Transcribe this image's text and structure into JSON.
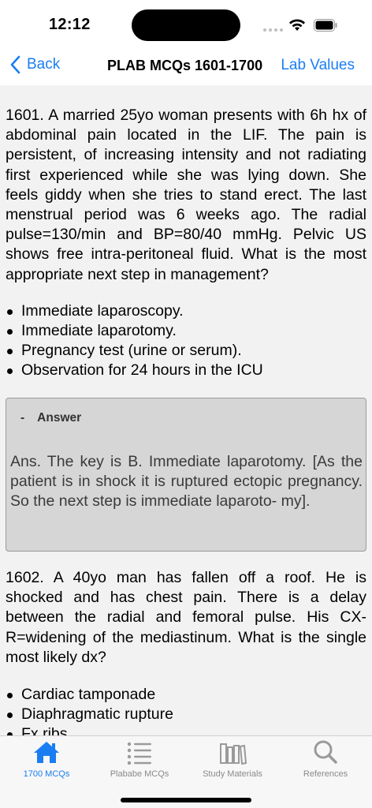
{
  "status": {
    "time": "12:12"
  },
  "nav": {
    "back_label": "Back",
    "title": "PLAB MCQs 1601-1700",
    "right_label": "Lab Values"
  },
  "questions": [
    {
      "text": "1601. A married 25yo woman presents with 6h hx of abdominal pain located in the LIF. The pain is persistent, of increasing intensity and not radiating first experienced while she was lying down. She feels giddy when she tries to stand erect. The last menstrual period was 6 weeks ago. The radial pulse=130/min and BP=80/40 mmHg. Pelvic US shows free intra-peritoneal fluid. What is the most appropriate next step in management?",
      "options": [
        "Immediate laparoscopy.",
        "Immediate laparotomy.",
        "Pregnancy test (urine or serum).",
        "Observation for 24 hours in the ICU"
      ],
      "answer_toggle": "-",
      "answer_title": "Answer",
      "answer_text": "Ans. The key is B. Immediate laparotomy. [As the patient is in shock it is ruptured ectopic pregnancy. So the next step is immediate laparoto- my]."
    },
    {
      "text": "1602. A 40yo man has fallen off a roof. He is shocked and has chest pain. There is a delay between the radial and femoral pulse. His CX-R=widening of the mediastinum. What is the single most likely dx?",
      "options": [
        "Cardiac tamponade",
        "Diaphragmatic rupture",
        "Fx ribs"
      ]
    }
  ],
  "tabs": [
    {
      "label": "1700 MCQs",
      "icon": "home-icon",
      "active": true
    },
    {
      "label": "Plababe MCQs",
      "icon": "list-icon",
      "active": false
    },
    {
      "label": "Study Materials",
      "icon": "books-icon",
      "active": false
    },
    {
      "label": "References",
      "icon": "search-icon",
      "active": false
    }
  ],
  "colors": {
    "accent": "#1a7ef2",
    "content_bg": "#f2f2f2",
    "answer_bg": "#d6d6d6",
    "tab_inactive": "#8a8a8a"
  }
}
